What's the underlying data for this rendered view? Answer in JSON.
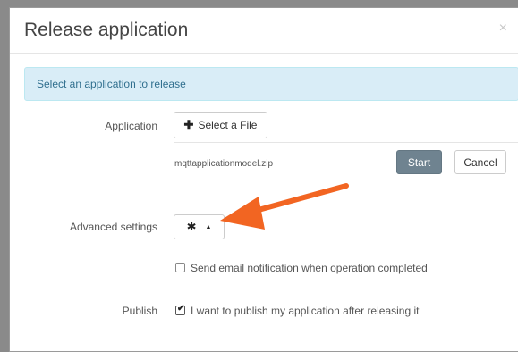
{
  "modal": {
    "title": "Release application",
    "close_glyph": "×"
  },
  "alert": {
    "text": "Select an application to release"
  },
  "application": {
    "label": "Application",
    "select_file_icon": "plus-icon",
    "select_file_label": "Select a File",
    "file_name": "mqttapplicationmodel.zip",
    "start_label": "Start",
    "cancel_label": "Cancel"
  },
  "advanced": {
    "label": "Advanced settings",
    "gear_icon": "gear-icon",
    "caret_icon": "caret-up-icon"
  },
  "email_notification": {
    "checked": false,
    "label": "Send email notification when operation completed"
  },
  "publish": {
    "label": "Publish",
    "checked": true,
    "checkbox_label": "I want to publish my application after releasing it"
  },
  "annotation": {
    "arrow_color": "#f26522"
  },
  "colors": {
    "alert_bg": "#d9edf7",
    "alert_text": "#31708f",
    "start_button": "#6f8390"
  }
}
